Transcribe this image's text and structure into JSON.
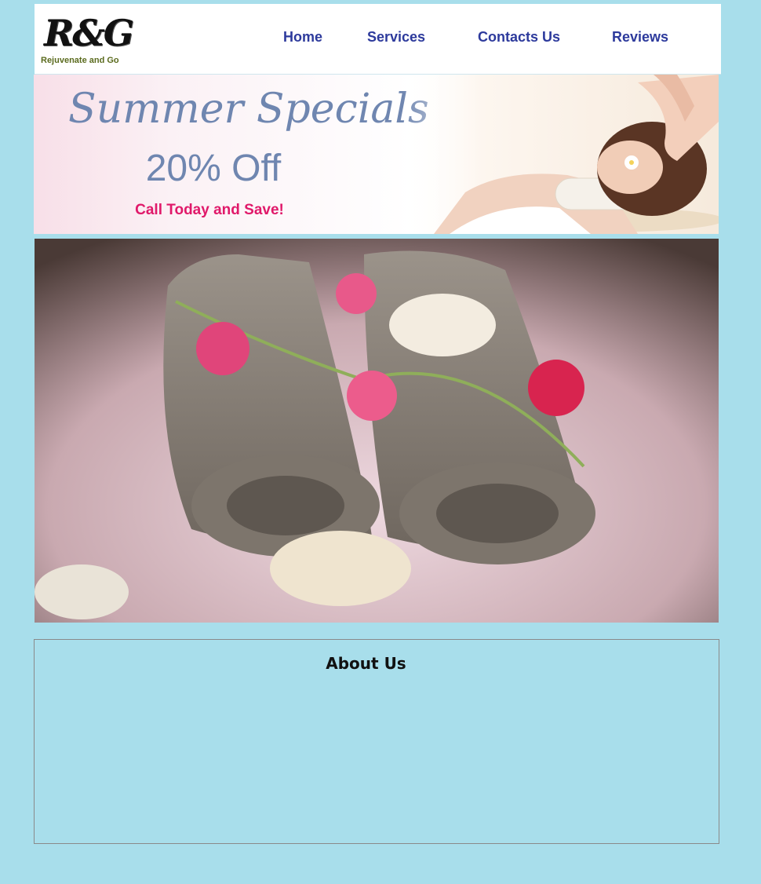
{
  "brand": {
    "logo_mark": "R&G",
    "tagline": "Rejuvenate and Go"
  },
  "nav": {
    "home": "Home",
    "services": "Services",
    "contacts": "Contacts Us",
    "reviews": "Reviews"
  },
  "banner": {
    "title": "Summer Specials",
    "discount": "20% Off",
    "cta": "Call Today and Save!"
  },
  "about": {
    "title": "About Us"
  },
  "colors": {
    "page_background": "#a8deeb",
    "nav_text": "#2d3a9c",
    "banner_title": "#6f86b0",
    "banner_cta": "#e0196a"
  }
}
